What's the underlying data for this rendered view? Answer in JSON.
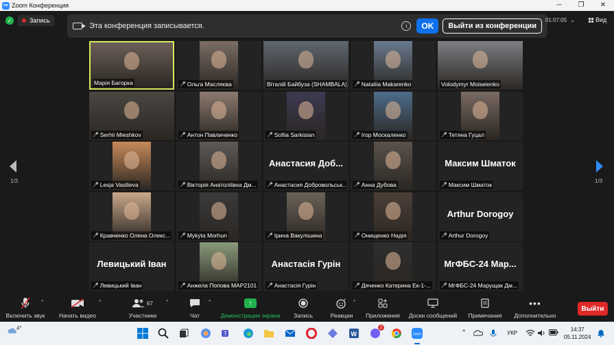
{
  "window": {
    "title": "Zoom Конференция",
    "logo_text": "zm"
  },
  "topbar": {
    "recording_label": "Запись",
    "timer": "01:07:05",
    "view_label": "Вид"
  },
  "banner": {
    "message": "Эта конференция записывается.",
    "ok_label": "OK",
    "leave_label": "Выйти из конференции"
  },
  "pagination": {
    "left": "1/3",
    "right": "1/3"
  },
  "participants": [
    {
      "name": "Марія Багорка",
      "muted": false,
      "active": true,
      "big": "",
      "photo": "#6b5f58"
    },
    {
      "name": "Ольга Масляєва",
      "muted": true,
      "active": false,
      "big": "",
      "photo": "#7c6e66"
    },
    {
      "name": "Віталій Байбуза (SHAMBALA)",
      "muted": false,
      "active": false,
      "big": "",
      "photo": "#5f6770"
    },
    {
      "name": "Nataliia Makarenko",
      "muted": true,
      "active": false,
      "big": "",
      "photo": "#6a7b8f"
    },
    {
      "name": "Volodymyr Moiseienko",
      "muted": false,
      "active": false,
      "big": "",
      "photo": "#7d7f84"
    },
    {
      "name": "Serhii Mieshkov",
      "muted": true,
      "active": false,
      "big": "",
      "photo": "#4a4641"
    },
    {
      "name": "Антон Павличенко",
      "muted": true,
      "active": false,
      "big": "",
      "photo": "#8c7a6e"
    },
    {
      "name": "Sofiia Sarkisian",
      "muted": true,
      "active": false,
      "big": "",
      "photo": "#3e3a52"
    },
    {
      "name": "Ігор Москаленко",
      "muted": true,
      "active": false,
      "big": "",
      "photo": "#4d6c8a"
    },
    {
      "name": "Тетяна Гуцал",
      "muted": true,
      "active": false,
      "big": "",
      "photo": "#7a6a62"
    },
    {
      "name": "Lesja Vasilieva",
      "muted": true,
      "active": false,
      "big": "",
      "photo": "#c88a5a"
    },
    {
      "name": "Вікторія Анатоліївна Дм...",
      "muted": true,
      "active": false,
      "big": "",
      "photo": "#5e5a58"
    },
    {
      "name": "Анастасия Добровольськ...",
      "muted": true,
      "active": false,
      "big": "Анастасия Доб...",
      "photo": ""
    },
    {
      "name": "Анна Дубова",
      "muted": true,
      "active": false,
      "big": "",
      "photo": "#5a534c"
    },
    {
      "name": "Максим Шматок",
      "muted": true,
      "active": false,
      "big": "Максим Шматок",
      "photo": ""
    },
    {
      "name": "Кравченко Олена Олекс...",
      "muted": true,
      "active": false,
      "big": "",
      "photo": "#c9a88a"
    },
    {
      "name": "Mykyta Morhun",
      "muted": true,
      "active": false,
      "big": "",
      "photo": "#3a3a3a"
    },
    {
      "name": "Ірина Вакулішина",
      "muted": true,
      "active": false,
      "big": "",
      "photo": "#6c6358"
    },
    {
      "name": "Онищенко Надія",
      "muted": true,
      "active": false,
      "big": "",
      "photo": "#4c3f38"
    },
    {
      "name": "Arthur Dorogoy",
      "muted": true,
      "active": false,
      "big": "Arthur Dorogoy",
      "photo": ""
    },
    {
      "name": "Левицький Іван",
      "muted": true,
      "active": false,
      "big": "Левицький Іван",
      "photo": ""
    },
    {
      "name": "Анжела Попова МАР2101",
      "muted": true,
      "active": false,
      "big": "",
      "photo": "#8a9a7a"
    },
    {
      "name": "Анастасія Гурін",
      "muted": true,
      "active": false,
      "big": "Анастасія Гурін",
      "photo": ""
    },
    {
      "name": "Дяченко Катерина Ек-1-...",
      "muted": true,
      "active": false,
      "big": "",
      "photo": "#2e2e2e"
    },
    {
      "name": "МгФБС-24 Марущак Дм...",
      "muted": true,
      "active": false,
      "big": "МгФБС-24 Мар...",
      "photo": ""
    }
  ],
  "toolbar": {
    "audio": "Включить звук",
    "video": "Начать видео",
    "participants": "Участники",
    "participants_count": "67",
    "chat": "Чат",
    "share": "Демонстрация экрана",
    "record": "Запись",
    "reactions": "Реакции",
    "apps": "Приложения",
    "whiteboards": "Доски сообщений",
    "notes": "Примечания",
    "more": "Дополнительно",
    "leave": "Выйти"
  },
  "taskbar": {
    "weather": "4°",
    "lang": "УКР",
    "time": "14:37",
    "date": "05.11.2024",
    "viber_badge": "2"
  },
  "colors": {
    "accent": "#0e71eb",
    "active_border": "#d9e95a",
    "leave": "#e02828",
    "share": "#22b14c"
  }
}
